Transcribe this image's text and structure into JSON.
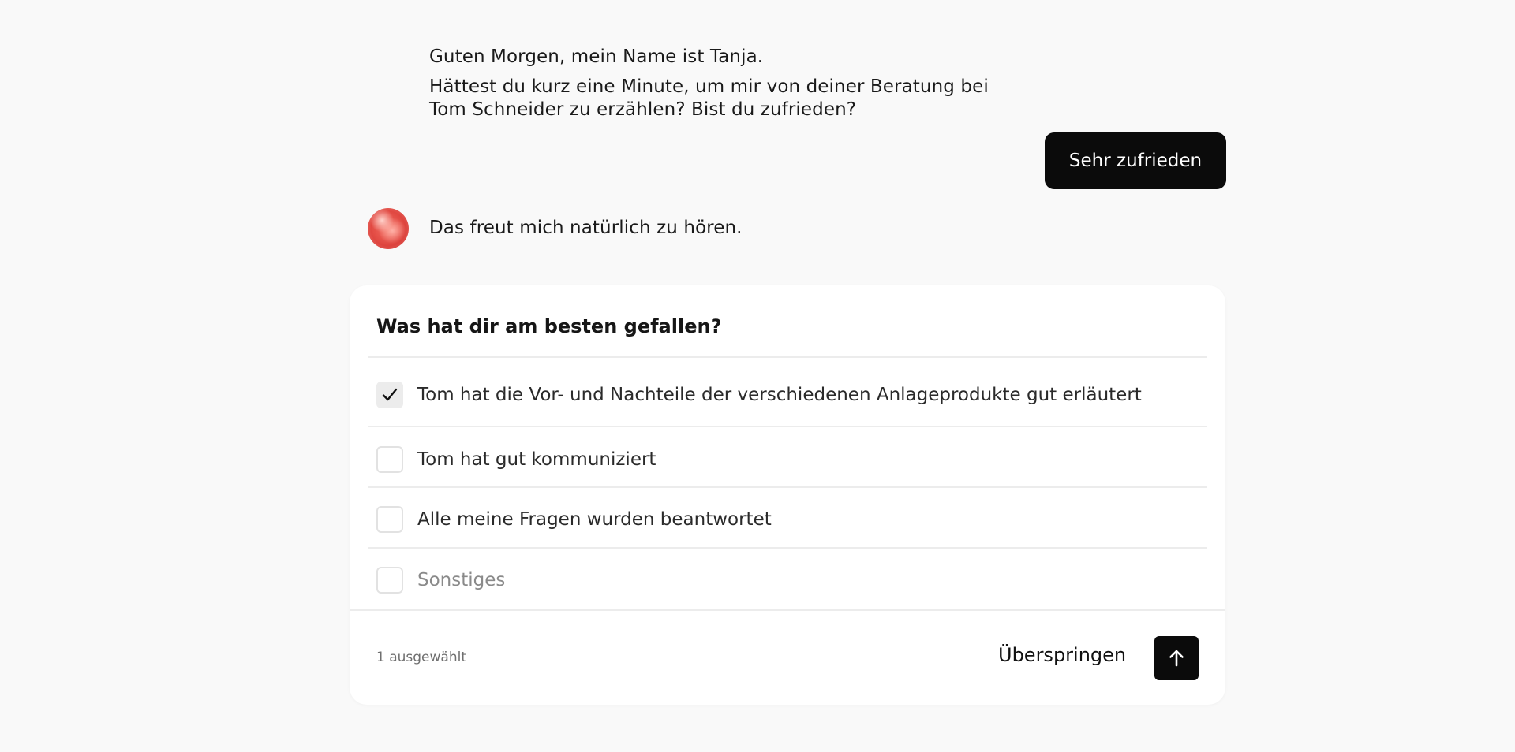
{
  "chat": {
    "greeting": "Guten Morgen, mein Name ist Tanja.",
    "question": "Hättest du kurz eine Minute, um mir von deiner Beratung bei Tom Schneider zu erzählen? Bist du zufrieden?",
    "user_reply": "Sehr zufrieden",
    "bot_response": "Das freut mich natürlich zu hören."
  },
  "survey": {
    "title": "Was hat dir am besten gefallen?",
    "options": [
      {
        "label": "Tom hat die Vor- und Nachteile der verschiedenen Anlageprodukte gut erläutert",
        "checked": true
      },
      {
        "label": "Tom hat gut kommuniziert",
        "checked": false
      },
      {
        "label": "Alle meine Fragen wurden beantwortet",
        "checked": false
      },
      {
        "label": "Sonstiges",
        "checked": false
      }
    ],
    "selected_count": "1 ausgewählt",
    "skip_label": "Überspringen"
  },
  "icons": {
    "avatar": "assistant-avatar-icon",
    "check": "checkmark-icon",
    "send": "arrow-up-icon"
  },
  "colors": {
    "background": "#f9f9f9",
    "accent": "#0b0b0b",
    "card": "#ffffff",
    "divider": "#ececec"
  }
}
